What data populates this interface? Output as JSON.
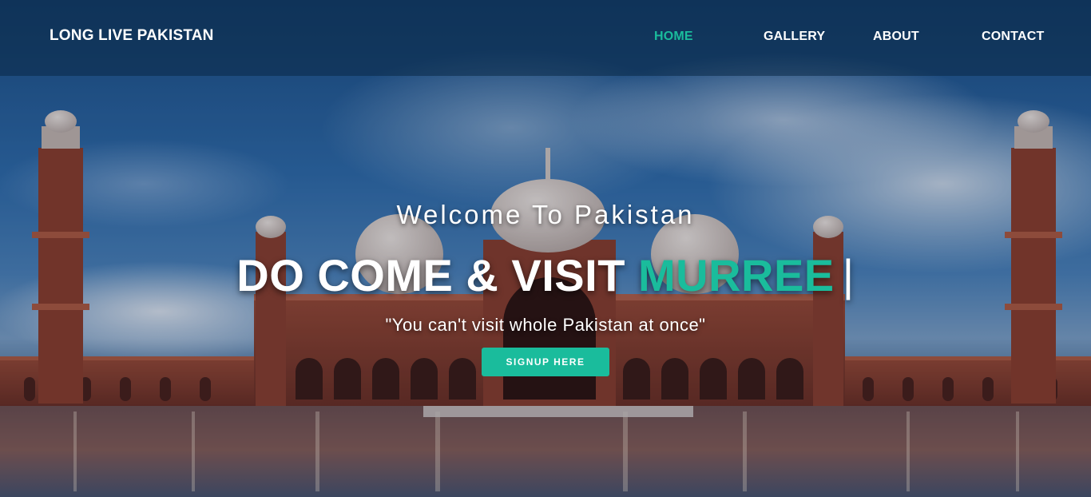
{
  "nav": {
    "brand": "LONG LIVE PAKISTAN",
    "links": [
      {
        "label": "HOME",
        "active": true
      },
      {
        "label": "GALLERY",
        "active": false
      },
      {
        "label": "ABOUT",
        "active": false
      },
      {
        "label": "CONTACT",
        "active": false
      }
    ]
  },
  "hero": {
    "welcome": "Welcome To Pakistan",
    "headline_prefix": "DO COME & VISIT",
    "headline_accent": "MURREE",
    "cursor": "|",
    "quote": "\"You can't visit whole Pakistan at once\"",
    "signup_label": "SIGNUP HERE"
  },
  "colors": {
    "accent": "#1abc9c",
    "text": "#ffffff",
    "navbar_overlay": "rgba(10,40,70,0.55)"
  }
}
